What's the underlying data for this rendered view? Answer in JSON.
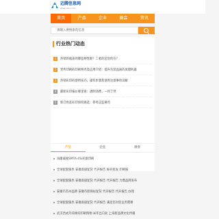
{
  "logo": {
    "name": "迈腾信息网",
    "url": "www.xxxx.com"
  },
  "nav": [
    "首页",
    "产品",
    "企业",
    "展会",
    "资讯"
  ],
  "search": {
    "placeholder": "请输入要搜索的信息"
  },
  "hot": {
    "title": "行业热门动态",
    "items": [
      {
        "num": "1",
        "text": "热销的瓶盖的哪些特性呢？二者的区别何在？",
        "color": "#f7941d"
      },
      {
        "num": "2",
        "text": "宣传印刷的印刷特点及应用介绍：提升包装品质的关键利器",
        "color": "#f7941d"
      },
      {
        "num": "3",
        "text": "热销彩印的使用技巧，操作步骤及使用注意事项详解",
        "color": "#f7941d"
      },
      {
        "num": "4",
        "text": "最新彩印报价哪里查：透明消费，一目了然",
        "color": "#999999"
      },
      {
        "num": "5",
        "text": "新订色差彩印如何挑选：参考这些要点",
        "color": "#999999"
      }
    ]
  },
  "tabs": [
    "产品",
    "企业",
    "展会"
  ],
  "biz": [
    "海康威视SMTA-4%托盘印刷",
    "全球配套服务 安徽高级配货 代开报告 报刊批发 印刷报",
    "全球配套服务 安徽高级配货 代开报告 代开报告 力鼎品牌发布",
    "安徽市苏州品牌 安徽市肥商标配货 代开报告 代开报告 办理",
    "全球配套服务 安徽高级配货 代开报告 满足您对您业务需要",
    "武汉西式丹托缘托印刷购物 米年出口处 上海新品牌文化传播"
  ]
}
